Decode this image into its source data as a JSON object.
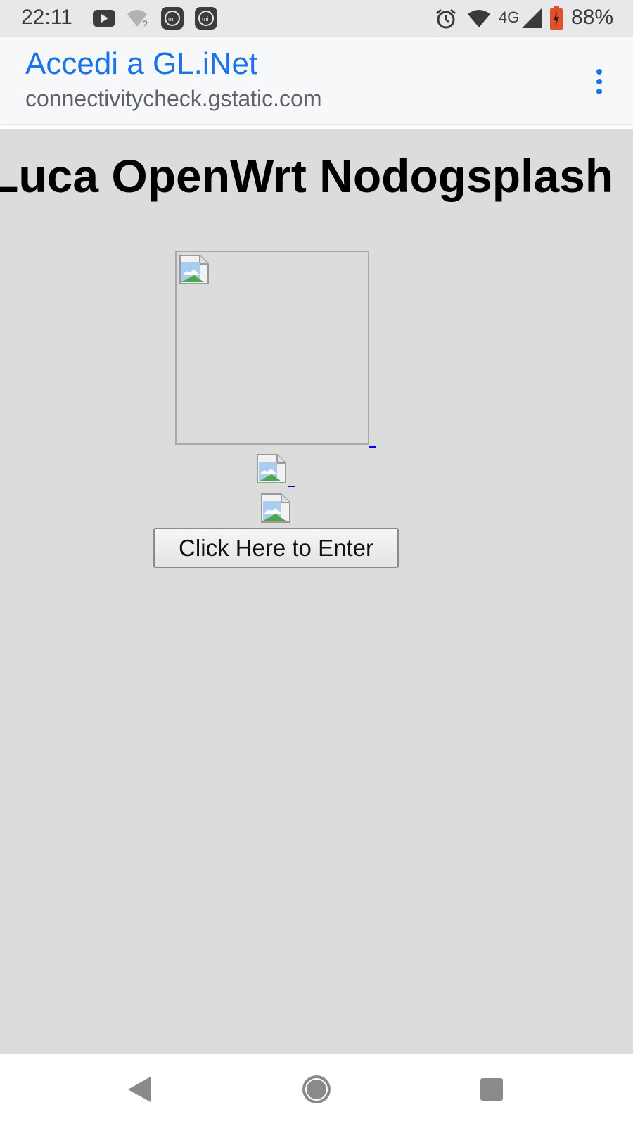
{
  "status_bar": {
    "time": "22:11",
    "network": "4G",
    "battery": "88%",
    "icons_left": [
      "youtube-icon",
      "wifi-unknown-icon",
      "mi-app-icon",
      "mi-app-icon"
    ],
    "icons_right": [
      "alarm-icon",
      "wifi-no-internet-icon",
      "signal-icon",
      "battery-charging-icon"
    ]
  },
  "header": {
    "title": "Accedi a GL.iNet",
    "url": "connectivitycheck.gstatic.com",
    "menu_icon": "more-vert-icon"
  },
  "page": {
    "heading": "Luca OpenWrt Nodogsplash",
    "button_label": "Click Here to Enter"
  },
  "nav_bar": {
    "icons": [
      "back-icon",
      "home-icon",
      "recent-apps-icon"
    ]
  },
  "colors": {
    "accent": "#1a73e8",
    "url_gray": "#5f6368",
    "content_bg": "#dcdcdd",
    "header_bg": "#f7f8fa",
    "status_bg": "#e8e8ea"
  }
}
